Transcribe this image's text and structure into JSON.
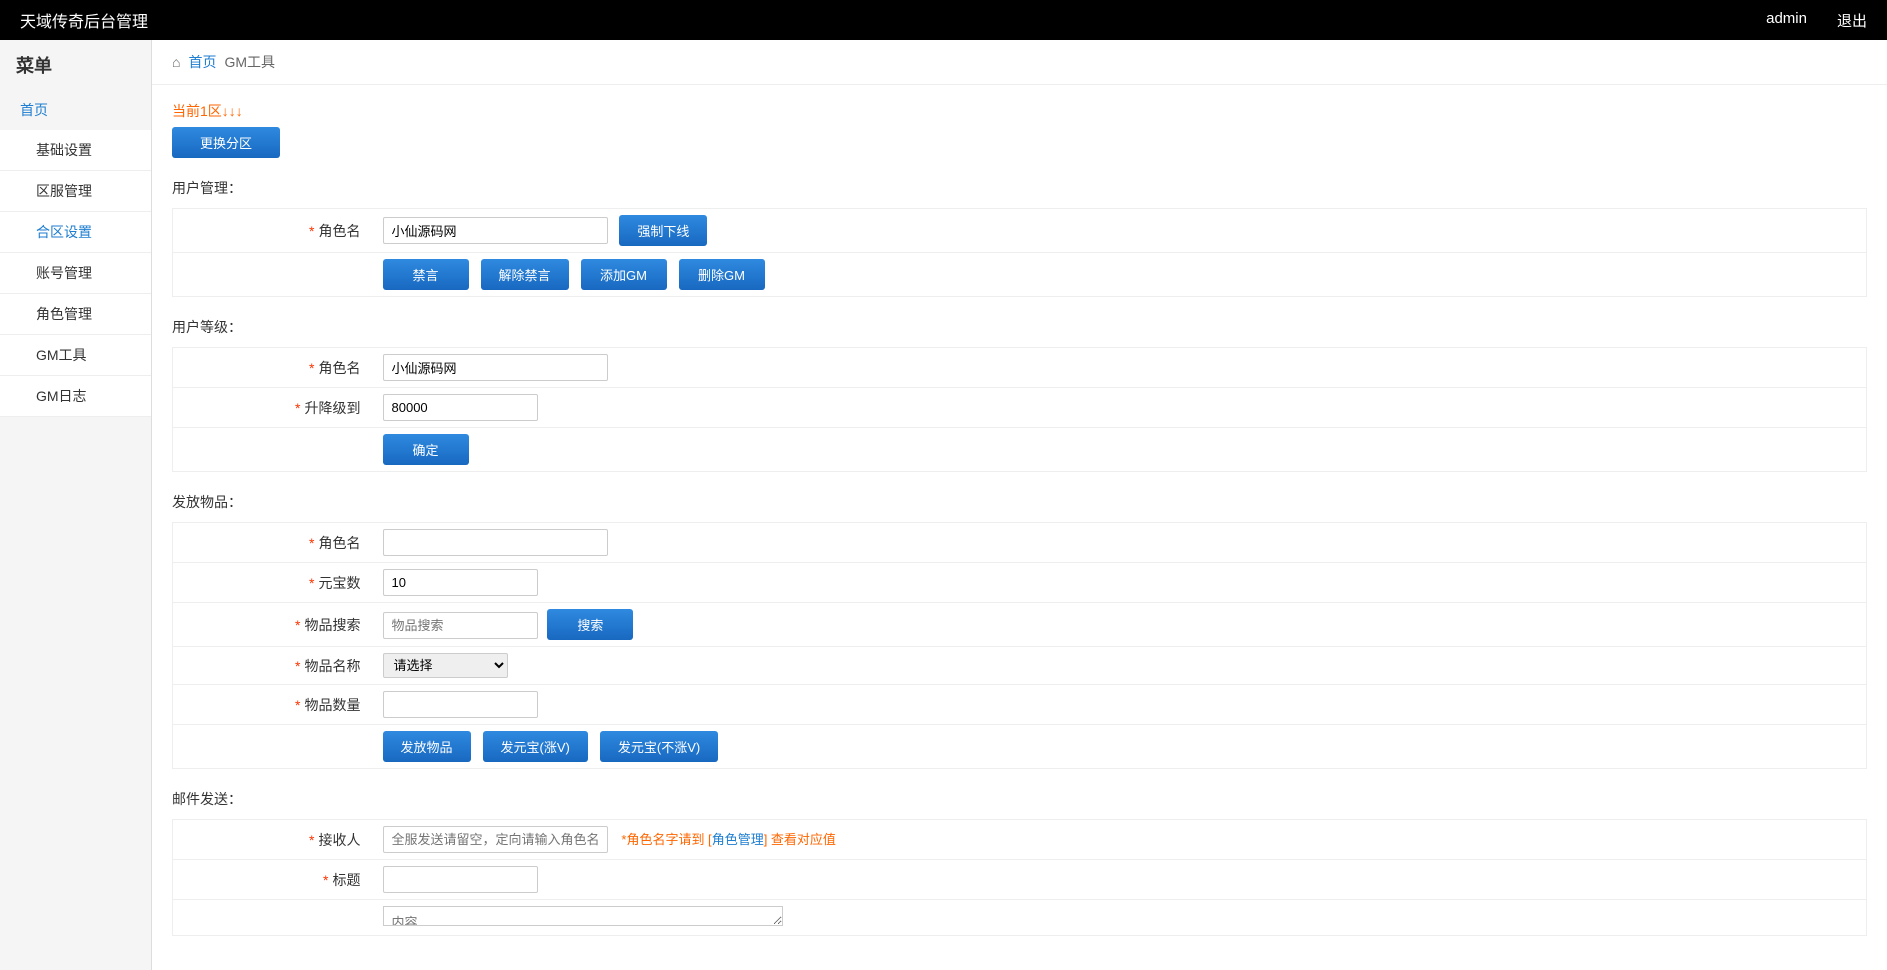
{
  "header": {
    "title": "天域传奇后台管理",
    "user": "admin",
    "logout": "退出"
  },
  "sidebar": {
    "title": "菜单",
    "home": "首页",
    "items": [
      {
        "label": "基础设置"
      },
      {
        "label": "区服管理"
      },
      {
        "label": "合区设置"
      },
      {
        "label": "账号管理"
      },
      {
        "label": "角色管理"
      },
      {
        "label": "GM工具"
      },
      {
        "label": "GM日志"
      }
    ]
  },
  "breadcrumb": {
    "home": "首页",
    "current": "GM工具"
  },
  "zone": {
    "notice": "当前1区↓↓↓",
    "change_btn": "更换分区"
  },
  "user_manage": {
    "title": "用户管理：",
    "role_label": "角色名",
    "role_value": "小仙源码网",
    "force_offline": "强制下线",
    "mute": "禁言",
    "unmute": "解除禁言",
    "add_gm": "添加GM",
    "del_gm": "删除GM"
  },
  "user_level": {
    "title": "用户等级：",
    "role_label": "角色名",
    "role_value": "小仙源码网",
    "level_label": "升降级到",
    "level_value": "80000",
    "confirm": "确定"
  },
  "give_item": {
    "title": "发放物品：",
    "role_label": "角色名",
    "role_value": "",
    "gold_label": "元宝数",
    "gold_value": "10",
    "search_label": "物品搜索",
    "search_placeholder": "物品搜索",
    "search_btn": "搜索",
    "item_name_label": "物品名称",
    "select_placeholder": "请选择",
    "qty_label": "物品数量",
    "qty_value": "",
    "give_btn": "发放物品",
    "gold_up_btn": "发元宝(涨V)",
    "gold_no_btn": "发元宝(不涨V)"
  },
  "mail": {
    "title": "邮件发送：",
    "recipient_label": "接收人",
    "recipient_placeholder": "全服发送请留空，定向请输入角色名字",
    "hint_prefix": "*角色名字请到 [",
    "hint_link": "角色管理",
    "hint_suffix": "] 查看对应值",
    "title_label": "标题",
    "title_value": "",
    "content_placeholder": "内容"
  }
}
